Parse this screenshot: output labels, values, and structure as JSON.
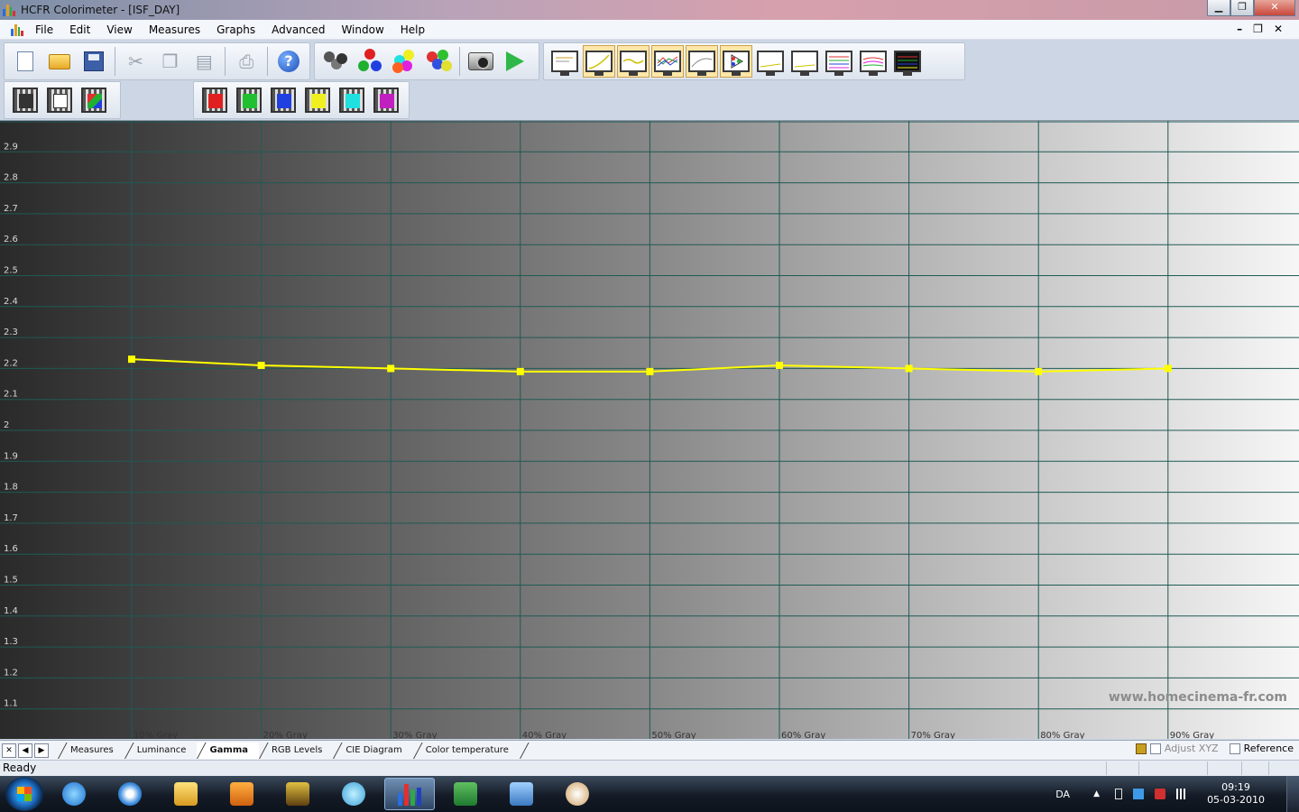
{
  "window": {
    "title": "HCFR Colorimeter - [ISF_DAY]",
    "minimize": "▁",
    "restore": "❐",
    "close": "✕"
  },
  "menu": {
    "items": [
      "File",
      "Edit",
      "View",
      "Measures",
      "Graphs",
      "Advanced",
      "Window",
      "Help"
    ],
    "mdi_minimize": "–",
    "mdi_restore": "❐",
    "mdi_close": "✕"
  },
  "toolbar": {
    "main_icons": [
      "new-document-icon",
      "open-folder-icon",
      "save-icon",
      "cut-icon",
      "copy-icon",
      "paste-icon",
      "print-icon",
      "help-icon",
      "sensor-icon",
      "primary-colors-icon",
      "secondary-colors-icon",
      "color-balls-icon",
      "camera-icon",
      "play-icon"
    ],
    "view_icons": [
      "view-luminance-icon",
      "view-gamma-icon",
      "view-gamma-curve-icon",
      "view-rgb-icon",
      "view-cie-icon",
      "view-cie-chart-icon",
      "view-blank-1-icon",
      "view-blank-2-icon",
      "view-multi-line-icon",
      "view-rgb-lines-icon",
      "view-spectrum-icon"
    ],
    "measure_icons": [
      "measure-gray-icon",
      "measure-near-black-icon",
      "measure-primaries-icon",
      "measure-red-icon",
      "measure-green-icon",
      "measure-blue-icon",
      "measure-yellow-icon",
      "measure-cyan-icon",
      "measure-magenta-icon"
    ]
  },
  "chart_data": {
    "type": "line",
    "title": "",
    "xlabel": "",
    "ylabel": "",
    "categories": [
      "10% Gray",
      "20% Gray",
      "30% Gray",
      "40% Gray",
      "50% Gray",
      "60% Gray",
      "70% Gray",
      "80% Gray",
      "90% Gray"
    ],
    "series": [
      {
        "values": [
          2.23,
          2.21,
          2.2,
          2.19,
          2.19,
          2.21,
          2.2,
          2.19,
          2.2
        ],
        "color": "#ffff00"
      }
    ],
    "yticks": [
      "1.1",
      "1.2",
      "1.3",
      "1.4",
      "1.5",
      "1.6",
      "1.7",
      "1.8",
      "1.9",
      "2",
      "2.1",
      "2.2",
      "2.3",
      "2.4",
      "2.5",
      "2.6",
      "2.7",
      "2.8",
      "2.9"
    ],
    "ylim": [
      1.0,
      3.0
    ],
    "grid": true,
    "grid_color": "#1f5a55",
    "background": "gray-gradient",
    "watermark": "www.homecinema-fr.com"
  },
  "tabs": {
    "items": [
      "Measures",
      "Luminance",
      "Gamma",
      "RGB Levels",
      "CIE Diagram",
      "Color temperature"
    ],
    "active": "Gamma",
    "nav": [
      "✕",
      "◀",
      "▶"
    ],
    "adjust_xyz": "Adjust XYZ",
    "reference": "Reference"
  },
  "status": {
    "text": "Ready"
  },
  "taskbar": {
    "language": "DA",
    "time": "09:19",
    "date": "05-03-2010",
    "apps": [
      "internet-explorer-icon",
      "safari-icon",
      "file-explorer-icon",
      "media-player-icon",
      "powerdvd-icon",
      "messenger-icon",
      "hcfr-icon",
      "excel-icon",
      "picture-viewer-icon",
      "paint-icon"
    ]
  }
}
